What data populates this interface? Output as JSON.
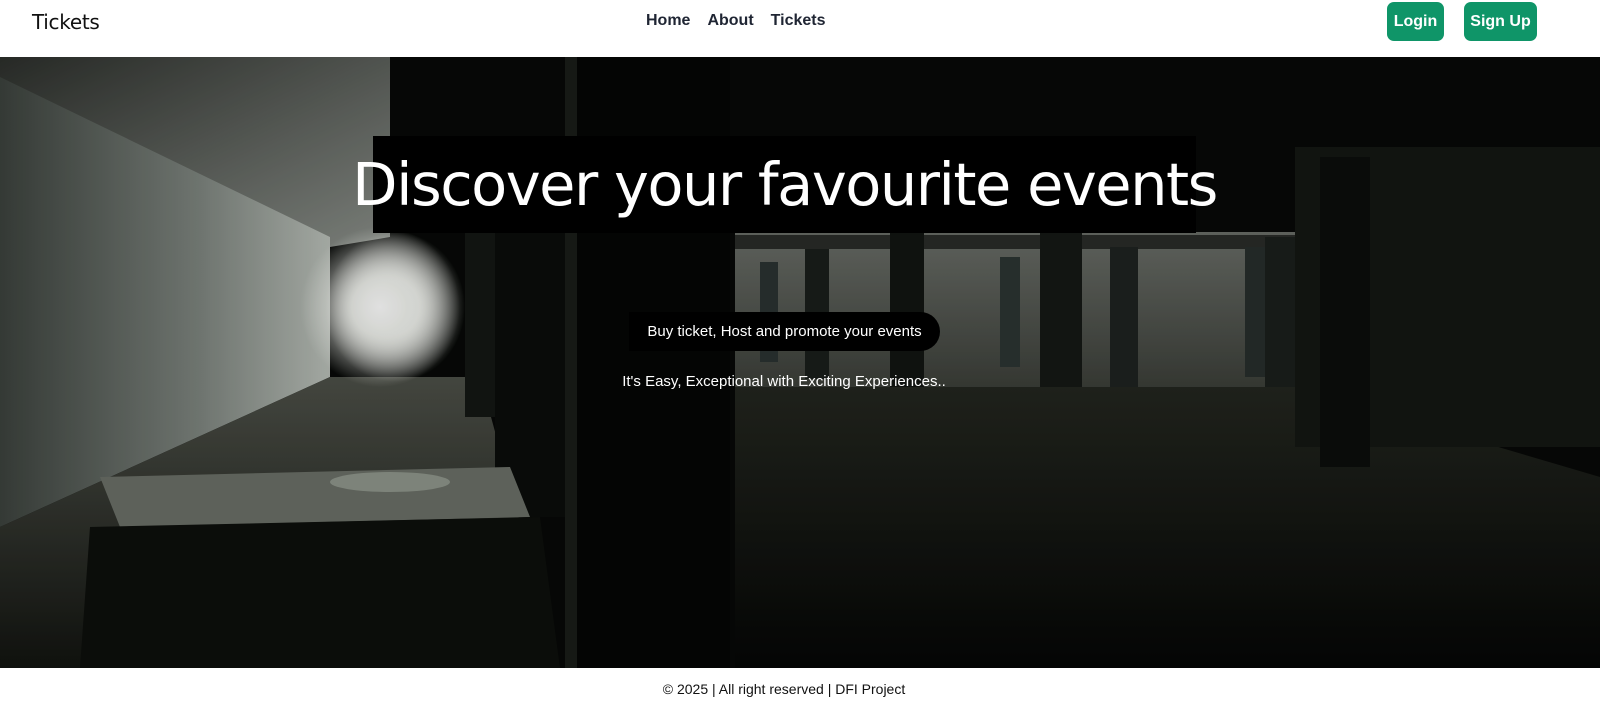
{
  "nav": {
    "brand": "Tickets",
    "links": [
      "Home",
      "About",
      "Tickets"
    ],
    "login_label": "Login",
    "signup_label": "Sign Up",
    "accent_color": "#0f9568"
  },
  "hero": {
    "title": "Discover your favourite events",
    "pill_text": "Buy ticket, Host and promote your events",
    "tagline": "It's Easy, Exceptional with Exciting Experiences..",
    "background": "dark underground parking garage photo"
  },
  "footer": {
    "text": "© 2025 | All right reserved | DFI Project"
  }
}
